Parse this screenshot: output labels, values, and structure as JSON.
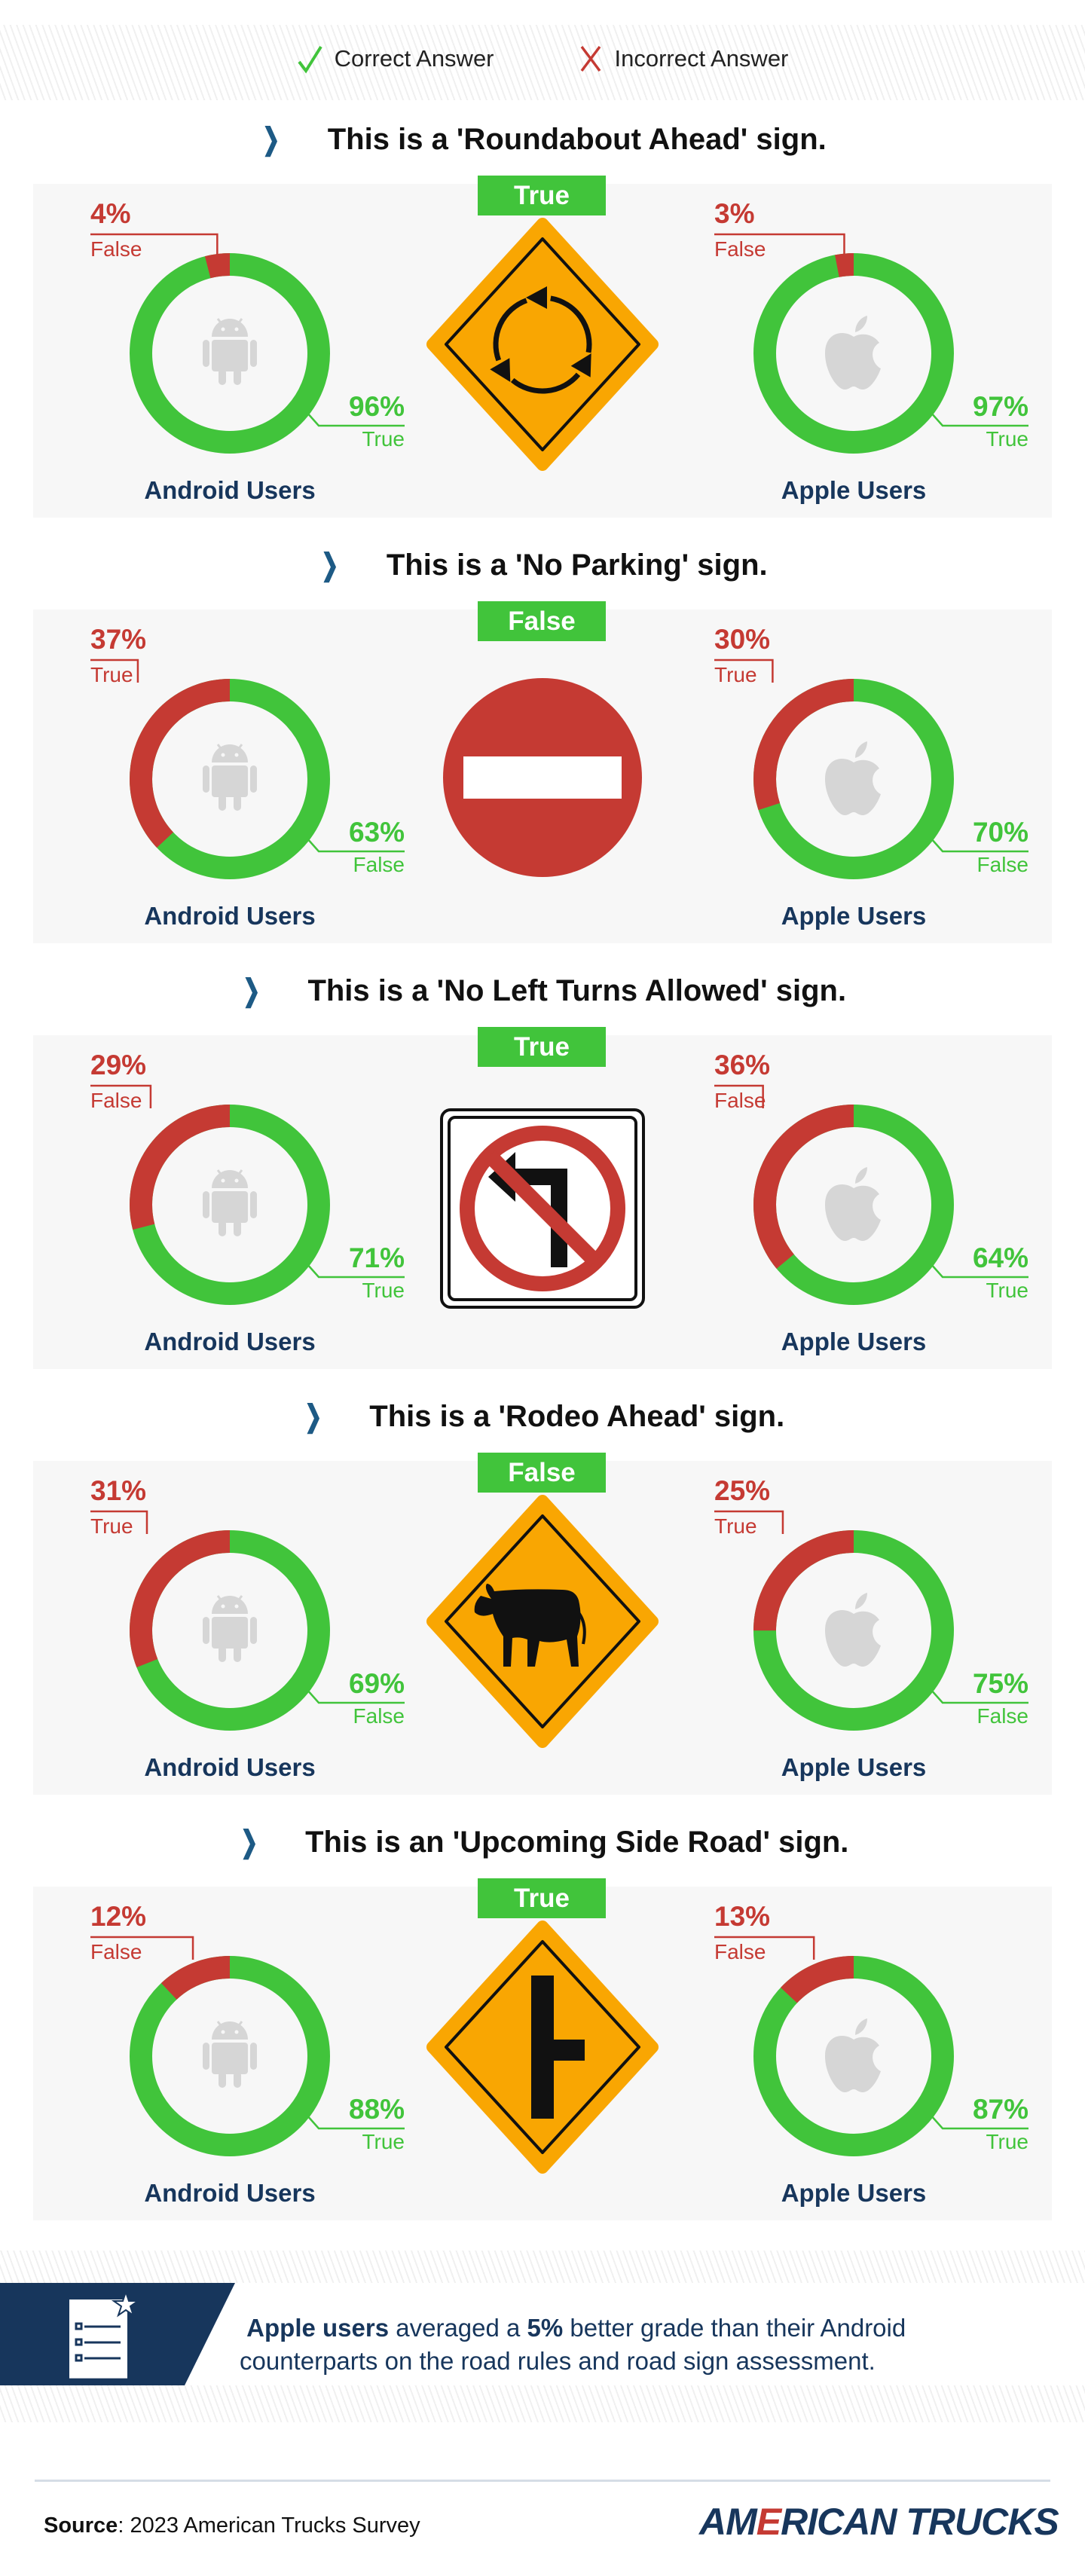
{
  "legend": {
    "correct": "Correct Answer",
    "incorrect": "Incorrect Answer",
    "correct_icon": "check-icon",
    "incorrect_icon": "x-icon"
  },
  "colors": {
    "correct": "#41c43b",
    "incorrect": "#c53a33",
    "navy": "#17365c",
    "sign_orange": "#f9a602",
    "chevron": "#1d5a85"
  },
  "chart_data": {
    "type": "pie",
    "variant": "donut",
    "group_labels": [
      "Android Users",
      "Apple Users"
    ],
    "questions": [
      {
        "title": "This is a 'Roundabout Ahead' sign.",
        "sign": "roundabout-sign",
        "answer": "True",
        "android": {
          "incorrect": {
            "value": 4,
            "label": "4%",
            "answer": "False"
          },
          "correct": {
            "value": 96,
            "label": "96%",
            "answer": "True"
          }
        },
        "apple": {
          "incorrect": {
            "value": 3,
            "label": "3%",
            "answer": "False"
          },
          "correct": {
            "value": 97,
            "label": "97%",
            "answer": "True"
          }
        }
      },
      {
        "title": "This is a 'No Parking' sign.",
        "sign": "no-entry-sign",
        "answer": "False",
        "android": {
          "incorrect": {
            "value": 37,
            "label": "37%",
            "answer": "True"
          },
          "correct": {
            "value": 63,
            "label": "63%",
            "answer": "False"
          }
        },
        "apple": {
          "incorrect": {
            "value": 30,
            "label": "30%",
            "answer": "True"
          },
          "correct": {
            "value": 70,
            "label": "70%",
            "answer": "False"
          }
        }
      },
      {
        "title": "This is a 'No Left Turns Allowed' sign.",
        "sign": "no-left-turn-sign",
        "answer": "True",
        "android": {
          "incorrect": {
            "value": 29,
            "label": "29%",
            "answer": "False"
          },
          "correct": {
            "value": 71,
            "label": "71%",
            "answer": "True"
          }
        },
        "apple": {
          "incorrect": {
            "value": 36,
            "label": "36%",
            "answer": "False"
          },
          "correct": {
            "value": 64,
            "label": "64%",
            "answer": "True"
          }
        }
      },
      {
        "title": "This is a 'Rodeo Ahead' sign.",
        "sign": "cattle-crossing-sign",
        "answer": "False",
        "android": {
          "incorrect": {
            "value": 31,
            "label": "31%",
            "answer": "True"
          },
          "correct": {
            "value": 69,
            "label": "69%",
            "answer": "False"
          }
        },
        "apple": {
          "incorrect": {
            "value": 25,
            "label": "25%",
            "answer": "True"
          },
          "correct": {
            "value": 75,
            "label": "75%",
            "answer": "False"
          }
        }
      },
      {
        "title": "This is an 'Upcoming Side Road' sign.",
        "sign": "side-road-sign",
        "answer": "True",
        "android": {
          "incorrect": {
            "value": 12,
            "label": "12%",
            "answer": "False"
          },
          "correct": {
            "value": 88,
            "label": "88%",
            "answer": "True"
          }
        },
        "apple": {
          "incorrect": {
            "value": 13,
            "label": "13%",
            "answer": "False"
          },
          "correct": {
            "value": 87,
            "label": "87%",
            "answer": "True"
          }
        }
      }
    ]
  },
  "summary": {
    "icon": "checklist-star-icon",
    "bold_lead": "Apple users",
    "text_1": " averaged a ",
    "bold_pct": "5%",
    "text_2": " better grade than their Android counterparts on the road rules and road sign assessment."
  },
  "footer": {
    "source_label": "Source",
    "source_text": ": 2023 American Trucks Survey",
    "logo_parts": [
      "AM",
      "E",
      "RICAN TRUCKS"
    ]
  }
}
